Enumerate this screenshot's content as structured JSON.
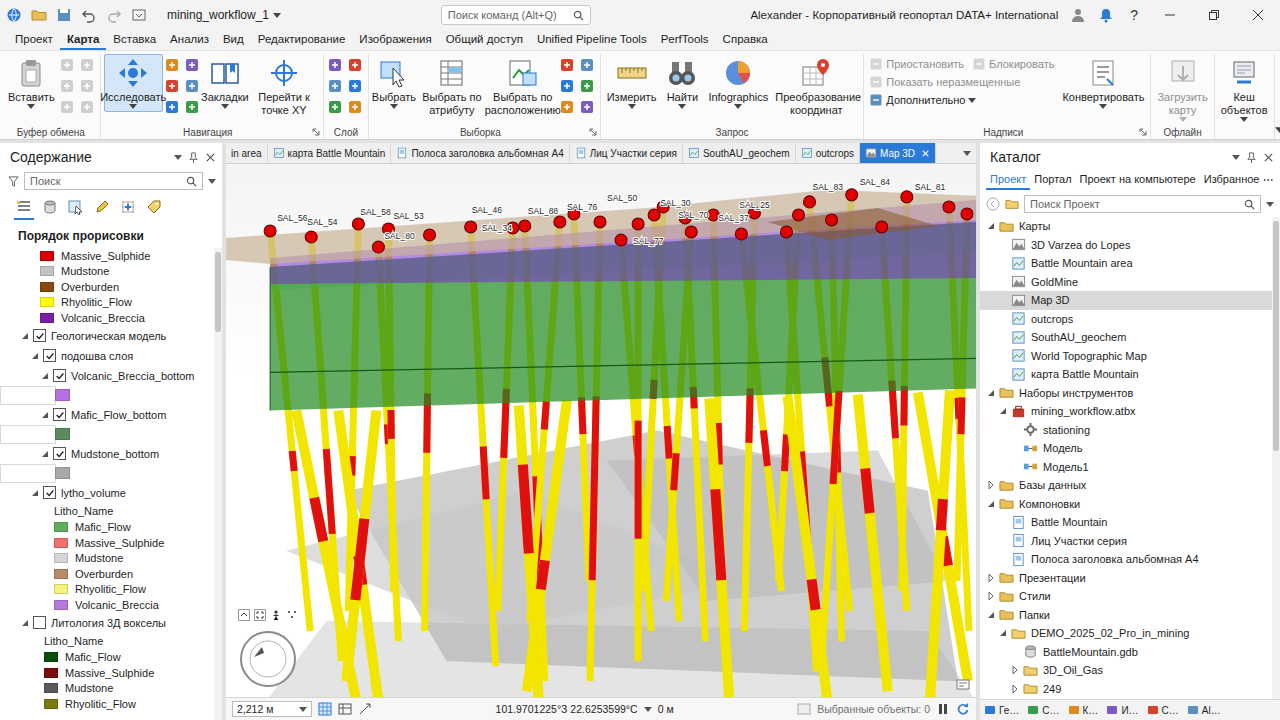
{
  "window": {
    "title": "mining_workflow_1",
    "command_search": "Поиск команд (Alt+Q)",
    "user": "Alexander - Корпоративный геопортал DATA+ International",
    "help": "?"
  },
  "ribbon_tabs": [
    {
      "label": "Проект",
      "selected": false
    },
    {
      "label": "Карта",
      "selected": true
    },
    {
      "label": "Вставка",
      "selected": false
    },
    {
      "label": "Анализ",
      "selected": false
    },
    {
      "label": "Вид",
      "selected": false
    },
    {
      "label": "Редактирование",
      "selected": false
    },
    {
      "label": "Изображения",
      "selected": false
    },
    {
      "label": "Общий доступ",
      "selected": false
    },
    {
      "label": "Unified Pipeline Tools",
      "selected": false
    },
    {
      "label": "PerfTools",
      "selected": false
    },
    {
      "label": "Справка",
      "selected": false
    }
  ],
  "ribbon_groups": [
    {
      "title": "Буфер обмена",
      "launcher": false,
      "items": [
        {
          "kind": "large",
          "label": "Вставить",
          "dropdown": true,
          "disabled": false,
          "selected": false
        },
        {
          "kind": "tools",
          "disabled": true
        }
      ]
    },
    {
      "title": "Навигация",
      "launcher": true,
      "items": [
        {
          "kind": "large",
          "label": "Исследовать",
          "dropdown": true,
          "disabled": false,
          "selected": true
        },
        {
          "kind": "tools",
          "disabled": false
        },
        {
          "kind": "large",
          "label": "Закладки",
          "dropdown": true,
          "disabled": false,
          "selected": false
        },
        {
          "kind": "large",
          "label": "Перейти к точке XY",
          "dropdown": false,
          "disabled": false,
          "selected": false
        }
      ]
    },
    {
      "title": "Слой",
      "launcher": false,
      "items": [
        {
          "kind": "tools",
          "disabled": false
        }
      ]
    },
    {
      "title": "Выборка",
      "launcher": true,
      "items": [
        {
          "kind": "large",
          "label": "Выбрать",
          "dropdown": true,
          "disabled": false,
          "selected": false
        },
        {
          "kind": "large",
          "label": "Выбрать по атрибуту",
          "dropdown": false,
          "disabled": false,
          "selected": false
        },
        {
          "kind": "large",
          "label": "Выбрать по расположению",
          "dropdown": false,
          "disabled": false,
          "selected": false
        },
        {
          "kind": "tools",
          "disabled": false
        }
      ]
    },
    {
      "title": "Запрос",
      "launcher": false,
      "items": [
        {
          "kind": "large",
          "label": "Измерить",
          "dropdown": true,
          "disabled": false,
          "selected": false
        },
        {
          "kind": "large",
          "label": "Найти",
          "dropdown": true,
          "disabled": false,
          "selected": false
        },
        {
          "kind": "large",
          "label": "Infographics",
          "dropdown": true,
          "disabled": false,
          "selected": false
        },
        {
          "kind": "large",
          "label": "Преобразование координат",
          "dropdown": false,
          "disabled": false,
          "selected": false
        }
      ]
    },
    {
      "title": "Надписи",
      "launcher": true,
      "items": [
        {
          "kind": "stack",
          "rows": [
            [
              {
                "label": "Приостановить",
                "dropdown": false,
                "disabled": true
              },
              {
                "label": "Блокировать",
                "dropdown": false,
                "disabled": true
              }
            ],
            [
              {
                "label": "Показать неразмещенные",
                "dropdown": false,
                "disabled": true
              }
            ],
            [
              {
                "label": "Дополнительно",
                "dropdown": true,
                "disabled": false
              }
            ]
          ]
        },
        {
          "kind": "large",
          "label": "Конвертировать",
          "dropdown": true,
          "disabled": false,
          "selected": false
        }
      ]
    },
    {
      "title": "Офлайн",
      "launcher": false,
      "items": [
        {
          "kind": "large",
          "label": "Загрузить карту",
          "dropdown": true,
          "disabled": true,
          "selected": false
        }
      ]
    },
    {
      "launcher": false,
      "items": [
        {
          "kind": "large",
          "label": "Кеш объектов",
          "dropdown": true,
          "disabled": false,
          "selected": false
        }
      ]
    }
  ],
  "contents": {
    "title": "Содержание",
    "search": "Поиск",
    "views": [
      {
        "selected": true
      },
      {
        "selected": false
      },
      {
        "selected": false
      },
      {
        "selected": false
      },
      {
        "selected": false
      },
      {
        "selected": false
      }
    ],
    "heading": "Порядок прорисовки",
    "legend_top": [
      {
        "label": "Massive_Sulphide",
        "color": "#d60000"
      },
      {
        "label": "Mudstone",
        "color": "#c4c4c4"
      },
      {
        "label": "Overburden",
        "color": "#8a4a0e"
      },
      {
        "label": "Rhyolitic_Flow",
        "color": "#ffff00"
      },
      {
        "label": "Volcanic_Breccia",
        "color": "#7a1fa8"
      }
    ],
    "layers": [
      {
        "label": "Геологическая модель",
        "checked": true,
        "expanded": true,
        "children": [
          {
            "label": "подошва слоя",
            "checked": true,
            "expanded": true,
            "children": [
              {
                "label": "Volcanic_Breccia_bottom",
                "checked": true,
                "expanded": true,
                "swatch": "#b46fe0"
              },
              {
                "label": "Mafic_Flow_bottom",
                "checked": true,
                "expanded": true,
                "swatch": "#5b8a5e"
              },
              {
                "label": "Mudstone_bottom",
                "checked": true,
                "expanded": true,
                "swatch": "#a8a8a8"
              }
            ]
          },
          {
            "label": "lytho_volume",
            "checked": true,
            "expanded": true,
            "field": "Litho_Name",
            "classes": [
              {
                "label": "Mafic_Flow",
                "color": "#5fae5f"
              },
              {
                "label": "Massive_Sulphide",
                "color": "#f07070"
              },
              {
                "label": "Mudstone",
                "color": "#d6d6d6"
              },
              {
                "label": "Overburden",
                "color": "#b8896a"
              },
              {
                "label": "Rhyolitic_Flow",
                "color": "#f6f27a"
              },
              {
                "label": "Volcanic_Breccia",
                "color": "#b57ad9"
              }
            ]
          }
        ]
      },
      {
        "label": "Литология 3Д вокселы",
        "checked": false,
        "expanded": true,
        "field": "Litho_Name",
        "classes": [
          {
            "label": "Mafic_Flow",
            "color": "#0a4d0a"
          },
          {
            "label": "Massive_Sulphide",
            "color": "#7a0d0d"
          },
          {
            "label": "Mudstone",
            "color": "#5a5a5a"
          },
          {
            "label": "Rhyolitic_Flow",
            "color": "#7d7a12"
          }
        ]
      }
    ]
  },
  "map_view": {
    "tabs": [
      {
        "label": "in area",
        "kind": "cut",
        "selected": false
      },
      {
        "label": "карта Battle Mountain",
        "kind": "map",
        "selected": false
      },
      {
        "label": "Полоса заголовка альбомная А4",
        "kind": "layout",
        "selected": false
      },
      {
        "label": "Лиц Участки серия",
        "kind": "layout",
        "selected": false
      },
      {
        "label": "SouthAU_geochem",
        "kind": "map",
        "selected": false
      },
      {
        "label": "outcrops",
        "kind": "map",
        "selected": false
      },
      {
        "label": "Map 3D",
        "kind": "scene",
        "selected": true
      }
    ],
    "labels": [
      "SAL_56",
      "SAL_54",
      "SAL_58",
      "SAL_53",
      "SAL_80",
      "SAL_46",
      "SAL_34",
      "SAL_88",
      "SAL_76",
      "SAL_50",
      "SAL_30",
      "SAL_77",
      "SAL_70",
      "SAL_37",
      "SAL_25",
      "SAL_83",
      "SAL_84",
      "SAL_81"
    ],
    "status": {
      "scale": "2,212 м",
      "coords": "101.9701225°З 22.6253599°С",
      "distance": "0 м",
      "selected_features": "Выбранные объекты: 0"
    }
  },
  "catalog": {
    "title": "Каталог",
    "tabs": [
      {
        "label": "Проект",
        "selected": true
      },
      {
        "label": "Портал",
        "selected": false
      },
      {
        "label": "Проект на компьютере",
        "selected": false
      },
      {
        "label": "Избранное",
        "selected": false
      }
    ],
    "search": "Поиск Проект",
    "tree": [
      {
        "label": "Карты",
        "kind": "group",
        "expanded": true,
        "selected": false,
        "children": [
          {
            "label": "3D Varzea do Lopes",
            "kind": "scene",
            "selected": false
          },
          {
            "label": "Battle Mountain area",
            "kind": "map",
            "selected": false
          },
          {
            "label": "GoldMine",
            "kind": "scene",
            "selected": false
          },
          {
            "label": "Map 3D",
            "kind": "scene",
            "selected": true
          },
          {
            "label": "outcrops",
            "kind": "map",
            "selected": false
          },
          {
            "label": "SouthAU_geochem",
            "kind": "map",
            "selected": false
          },
          {
            "label": "World Topographic Map",
            "kind": "map",
            "selected": false
          },
          {
            "label": "карта Battle Mountain",
            "kind": "map",
            "selected": false
          }
        ]
      },
      {
        "label": "Наборы инструментов",
        "kind": "group",
        "expanded": true,
        "selected": false,
        "children": [
          {
            "label": "mining_workflow.atbx",
            "kind": "toolbox",
            "expanded": true,
            "selected": false,
            "children": [
              {
                "label": "stationing",
                "kind": "tool",
                "selected": false
              },
              {
                "label": "Модель",
                "kind": "model",
                "selected": false
              },
              {
                "label": "Модель1",
                "kind": "model",
                "selected": false
              }
            ]
          }
        ]
      },
      {
        "label": "Базы данных",
        "kind": "group",
        "expanded": false,
        "selected": false
      },
      {
        "label": "Компоновки",
        "kind": "group",
        "expanded": true,
        "selected": false,
        "children": [
          {
            "label": "Battle Mountain",
            "kind": "layout",
            "selected": false
          },
          {
            "label": "Лиц Участки серия",
            "kind": "layout",
            "selected": false
          },
          {
            "label": "Полоса заголовка альбомная А4",
            "kind": "layout",
            "selected": false
          }
        ]
      },
      {
        "label": "Презентации",
        "kind": "group",
        "expanded": false,
        "selected": false
      },
      {
        "label": "Стили",
        "kind": "group",
        "expanded": false,
        "selected": false
      },
      {
        "label": "Папки",
        "kind": "group",
        "expanded": true,
        "selected": false,
        "children": [
          {
            "label": "DEMO_2025_02_Pro_in_mining",
            "kind": "folder",
            "expanded": true,
            "selected": false,
            "children": [
              {
                "label": "BattleMountain.gdb",
                "kind": "gdb",
                "selected": false
              },
              {
                "label": "3D_Oil_Gas",
                "kind": "folder",
                "expanded": false,
                "selected": false
              },
              {
                "label": "249",
                "kind": "folder",
                "expanded": false,
                "selected": false
              }
            ]
          }
        ]
      }
    ],
    "bottom_tabs": [
      "Ге…",
      "С…",
      "К…",
      "И…",
      "С…",
      "Al…"
    ]
  }
}
